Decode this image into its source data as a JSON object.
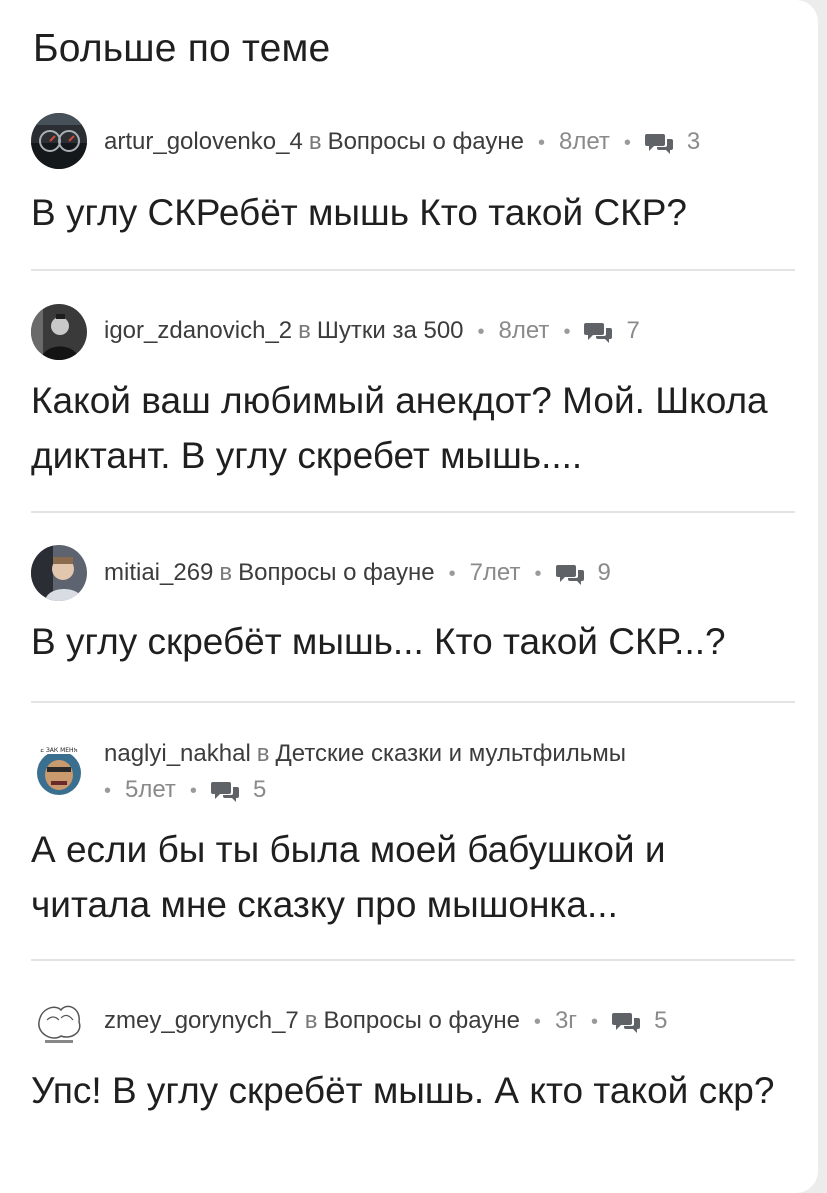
{
  "section_title": "Больше по теме",
  "in_word": "в",
  "colors": {
    "text": "#1f1f1f",
    "meta": "#5f6368",
    "divider": "#e3e3e3",
    "background": "#ffffff"
  },
  "items": [
    {
      "username": "artur_golovenko_4",
      "topic": "Вопросы о фауне",
      "age": "8лет",
      "comments": "3",
      "title": "В углу СКРебёт мышь Кто такой СКР?",
      "avatar": "dashboard-photo"
    },
    {
      "username": "igor_zdanovich_2",
      "topic": "Шутки за 500",
      "age": "8лет",
      "comments": "7",
      "title": "Какой ваш любимый анекдот? Мой. Школа диктант. В углу скребет мышь....",
      "avatar": "bw-person-photo"
    },
    {
      "username": "mitiai_269",
      "topic": "Вопросы о фауне",
      "age": "7лет",
      "comments": "9",
      "title": "В углу скребёт мышь... Кто такой СКР...?",
      "avatar": "car-selfie-photo"
    },
    {
      "username": "naglyi_nakhal",
      "topic": "Детские сказки и мультфильмы",
      "age": "5лет",
      "comments": "5",
      "title": "А если бы ты была моей бабушкой и читала мне сказку про мышонка...",
      "avatar": "cartoon-face-badge"
    },
    {
      "username": "zmey_gorynych_7",
      "topic": "Вопросы о фауне",
      "age": "3г",
      "comments": "5",
      "title": "Упс! В углу скребёт мышь. А кто такой скр?",
      "avatar": "sketch-drawing"
    }
  ]
}
